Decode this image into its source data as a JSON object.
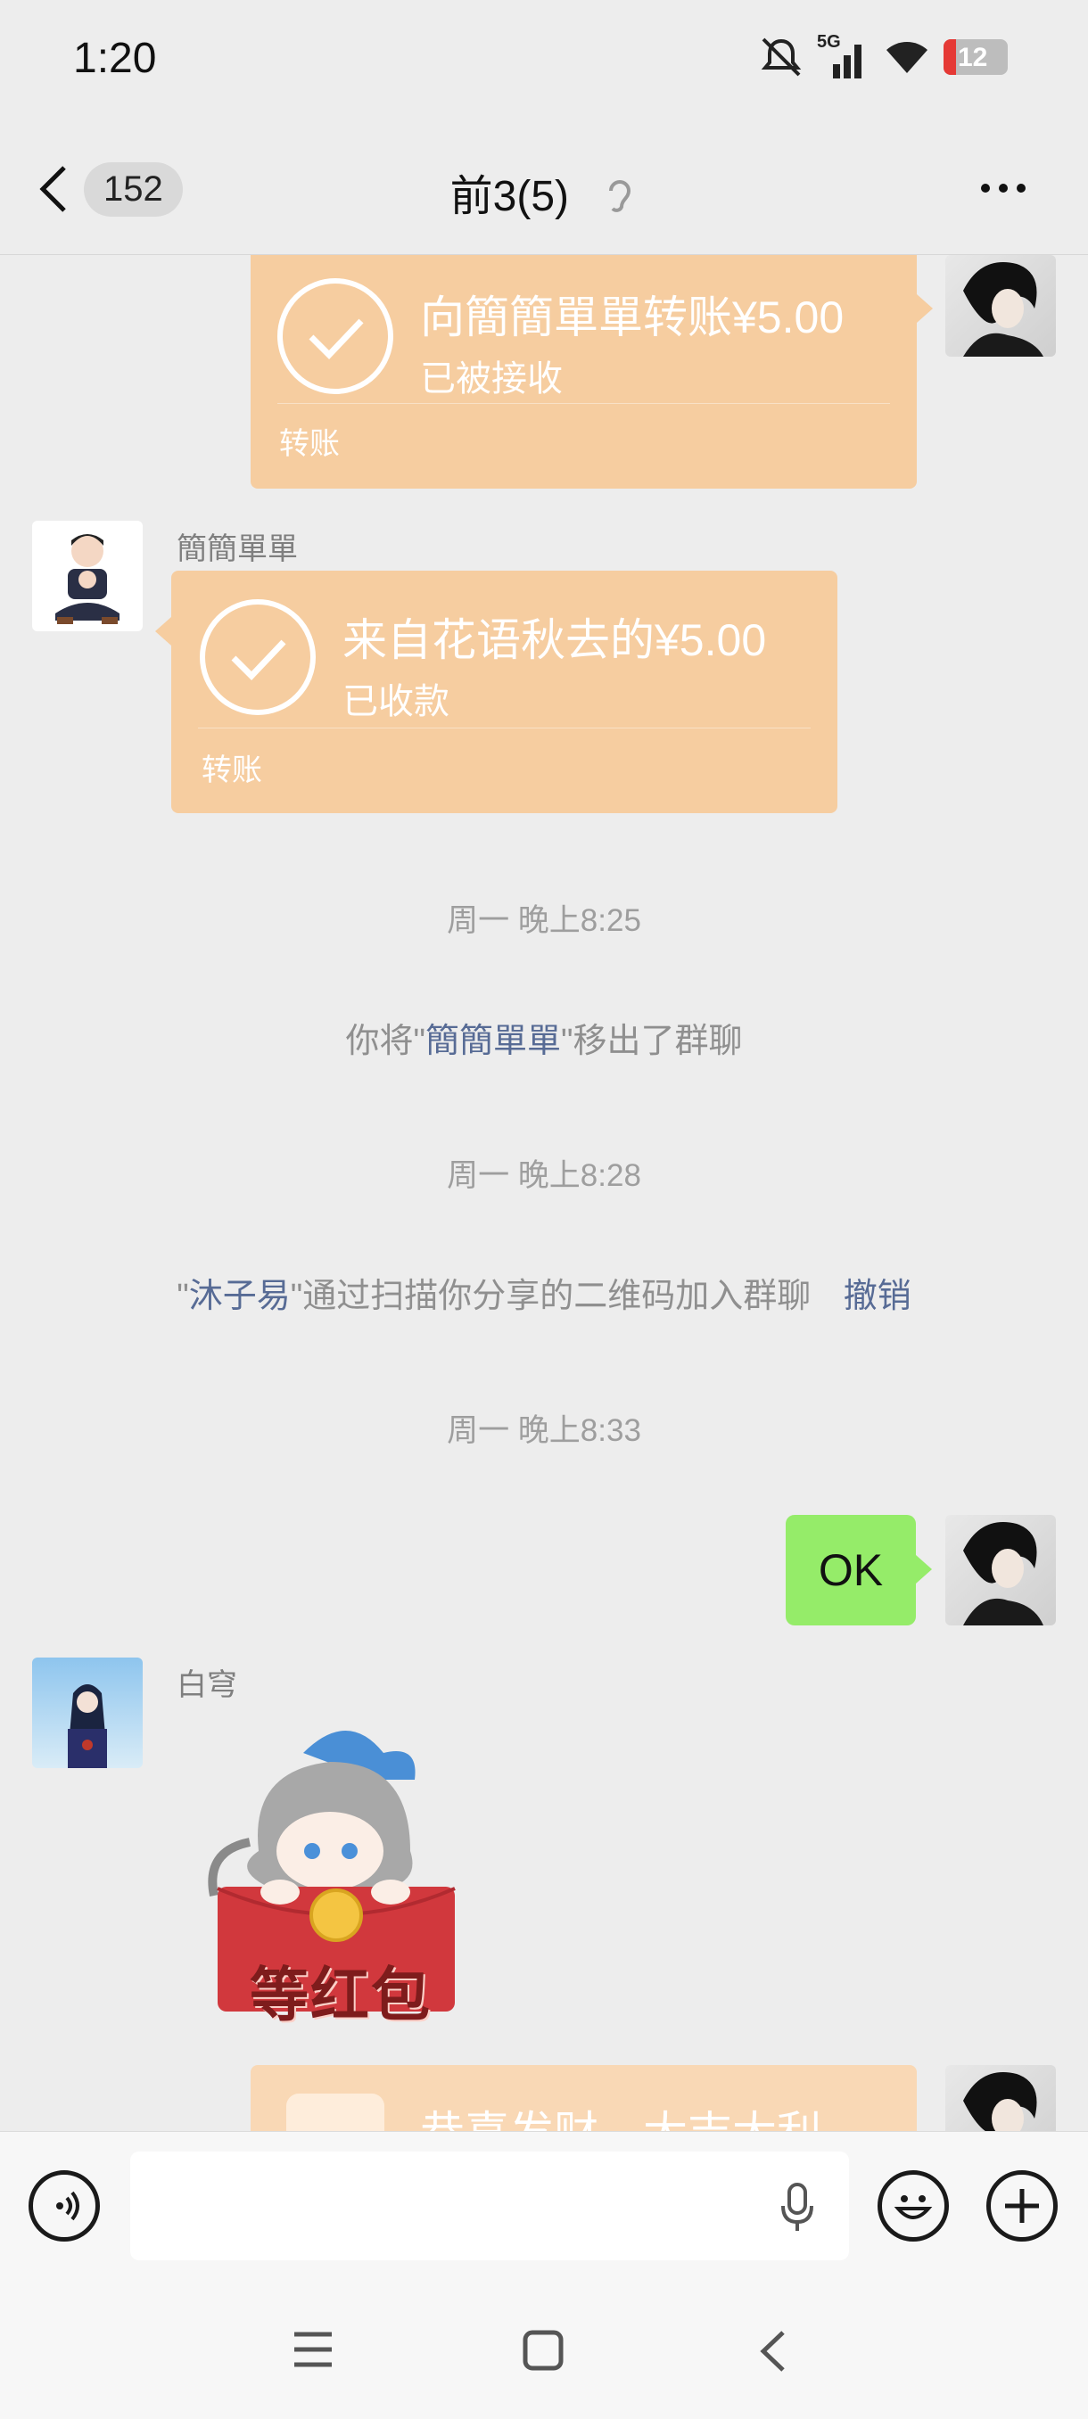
{
  "status": {
    "time": "1:20",
    "network": "5G",
    "battery": "12"
  },
  "nav": {
    "unread_count": "152",
    "title": "前3(5)"
  },
  "messages": {
    "transfer_sent": {
      "title": "向簡簡單單转账¥5.00",
      "status": "已被接收",
      "label": "转账"
    },
    "transfer_received": {
      "sender": "簡簡單單",
      "title": "来自花语秋去的¥5.00",
      "status": "已收款",
      "label": "转账"
    },
    "ts1": "周一 晚上8:25",
    "sys1": {
      "prefix": "你将\"",
      "name": "簡簡單單",
      "suffix": "\"移出了群聊"
    },
    "ts2": "周一 晚上8:28",
    "sys2": {
      "prefix": "\"",
      "name": "沐子易",
      "suffix": "\"通过扫描你分享的二维码加入群聊",
      "action": "撤销"
    },
    "ts3": "周一 晚上8:33",
    "ok_bubble": "OK",
    "sticker": {
      "sender": "白穹",
      "text": "等红包"
    },
    "red_packet_partial": "恭喜发财，大吉大利"
  },
  "colors": {
    "transfer_card": "#f6cda0",
    "self_bubble": "#95ec69",
    "link": "#576b95",
    "background": "#ededed"
  }
}
